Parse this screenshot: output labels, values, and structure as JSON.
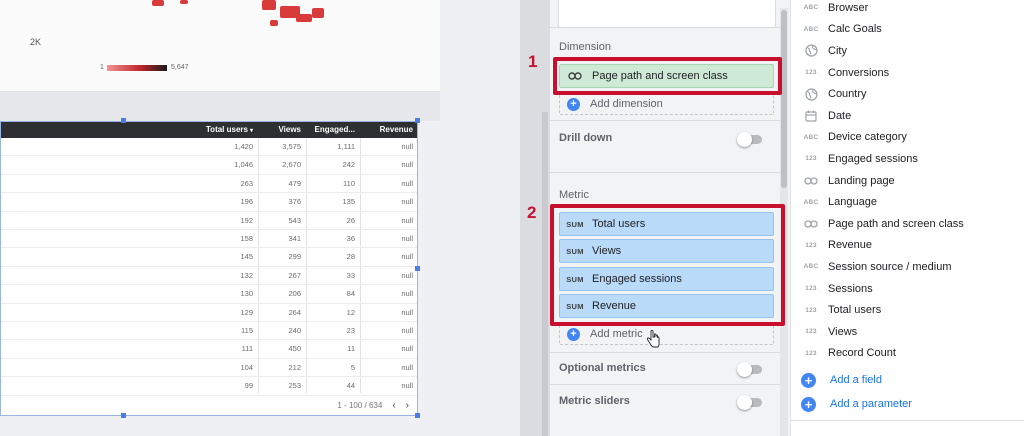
{
  "map": {
    "axis_label": "2K",
    "legend_min": "1",
    "legend_max": "5,647"
  },
  "table": {
    "headers": [
      "Total users",
      "Views",
      "Engaged...",
      "Revenue"
    ],
    "sort_indicator": "▾",
    "rows": [
      [
        "1,420",
        "3,575",
        "1,111",
        "null"
      ],
      [
        "1,046",
        "2,670",
        "242",
        "null"
      ],
      [
        "263",
        "479",
        "110",
        "null"
      ],
      [
        "196",
        "376",
        "135",
        "null"
      ],
      [
        "192",
        "543",
        "26",
        "null"
      ],
      [
        "158",
        "341",
        "36",
        "null"
      ],
      [
        "145",
        "299",
        "28",
        "null"
      ],
      [
        "132",
        "267",
        "33",
        "null"
      ],
      [
        "130",
        "206",
        "84",
        "null"
      ],
      [
        "129",
        "264",
        "12",
        "null"
      ],
      [
        "115",
        "240",
        "23",
        "null"
      ],
      [
        "111",
        "450",
        "11",
        "null"
      ],
      [
        "104",
        "212",
        "5",
        "null"
      ],
      [
        "99",
        "253",
        "44",
        "null"
      ]
    ],
    "pagination": "1 - 100 / 634",
    "prev": "‹",
    "next": "›"
  },
  "setup": {
    "dimension_title": "Dimension",
    "dimension_chip": "Page path and screen class",
    "add_dimension": "Add dimension",
    "drill_down": "Drill down",
    "metric_title": "Metric",
    "metrics": [
      {
        "agg": "SUM",
        "label": "Total users"
      },
      {
        "agg": "SUM",
        "label": "Views"
      },
      {
        "agg": "SUM",
        "label": "Engaged sessions"
      },
      {
        "agg": "SUM",
        "label": "Revenue"
      }
    ],
    "add_metric": "Add metric",
    "optional_metrics": "Optional metrics",
    "metric_sliders": "Metric sliders"
  },
  "annotations": {
    "marker_1": "1",
    "marker_2": "2",
    "color": "#c8102e"
  },
  "fields": {
    "items": [
      {
        "type": "ABC",
        "icon": "text-type-icon",
        "label": "Browser"
      },
      {
        "type": "ABC",
        "icon": "text-type-icon",
        "label": "Calc Goals"
      },
      {
        "type": "geo",
        "icon": "globe-icon",
        "label": "City"
      },
      {
        "type": "123",
        "icon": "number-type-icon",
        "label": "Conversions"
      },
      {
        "type": "geo",
        "icon": "globe-icon",
        "label": "Country"
      },
      {
        "type": "date",
        "icon": "calendar-icon",
        "label": "Date"
      },
      {
        "type": "ABC",
        "icon": "text-type-icon",
        "label": "Device category"
      },
      {
        "type": "123",
        "icon": "number-type-icon",
        "label": "Engaged sessions"
      },
      {
        "type": "link",
        "icon": "link-icon",
        "label": "Landing page"
      },
      {
        "type": "ABC",
        "icon": "text-type-icon",
        "label": "Language"
      },
      {
        "type": "link",
        "icon": "link-icon",
        "label": "Page path and screen class"
      },
      {
        "type": "123",
        "icon": "number-type-icon",
        "label": "Revenue"
      },
      {
        "type": "ABC",
        "icon": "text-type-icon",
        "label": "Session source / medium"
      },
      {
        "type": "123",
        "icon": "number-type-icon",
        "label": "Sessions"
      },
      {
        "type": "123",
        "icon": "number-type-icon",
        "label": "Total users"
      },
      {
        "type": "123",
        "icon": "number-type-icon",
        "label": "Views"
      },
      {
        "type": "123",
        "icon": "number-type-icon",
        "label": "Record Count"
      }
    ],
    "add_field": "Add a field",
    "add_parameter": "Add a parameter"
  },
  "colors": {
    "dimension_chip": "#ceead6",
    "metric_chip": "#b9daf8",
    "accent_blue": "#4285f4",
    "table_header": "#2d2f33"
  }
}
